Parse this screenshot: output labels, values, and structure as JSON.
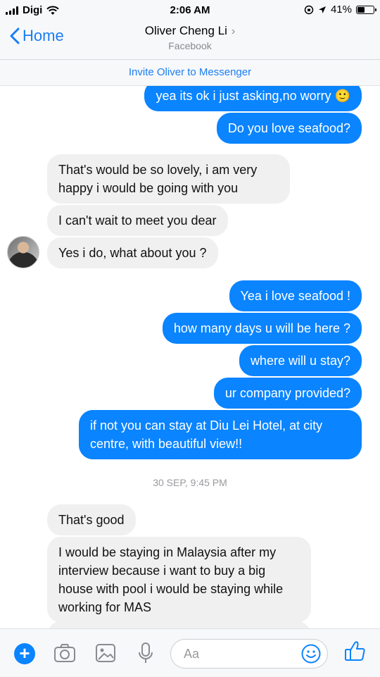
{
  "status_bar": {
    "carrier": "Digi",
    "time": "2:06 AM",
    "battery": "41%",
    "battery_level": 0.41
  },
  "header": {
    "back_label": "Home",
    "contact_name": "Oliver Cheng Li",
    "subtitle": "Facebook"
  },
  "invite_banner": "Invite Oliver to Messenger",
  "messages": [
    {
      "dir": "out",
      "text": "yea its ok i just asking,no worry 🙂"
    },
    {
      "dir": "out",
      "text": "Do you love seafood?"
    },
    {
      "dir": "in",
      "text": "That's would be so lovely, i am very happy i would be going with you"
    },
    {
      "dir": "in",
      "text": "I can't wait to meet you dear"
    },
    {
      "dir": "in",
      "text": "Yes i do, what about you ?"
    },
    {
      "dir": "out",
      "text": "Yea i love seafood !"
    },
    {
      "dir": "out",
      "text": "how many days u will be here ?"
    },
    {
      "dir": "out",
      "text": "where will u stay?"
    },
    {
      "dir": "out",
      "text": "ur company provided?"
    },
    {
      "dir": "out",
      "text": "if not you can stay at Diu Lei Hotel, at city centre, with beautiful view!!"
    },
    {
      "dir": "in",
      "text": "That's good"
    },
    {
      "dir": "in",
      "text": "I would be staying in Malaysia after my interview because i want to buy a big house with pool i would be staying while working for MAS"
    },
    {
      "dir": "in",
      "text": ""
    }
  ],
  "timestamp": "30 SEP, 9:45 PM",
  "composer": {
    "placeholder": "Aa"
  },
  "icons": {
    "add": "plus-circle-icon",
    "camera": "camera-icon",
    "gallery": "image-icon",
    "mic": "microphone-icon",
    "emoji": "smiley-icon",
    "like": "thumbs-up-icon"
  },
  "colors": {
    "accent": "#0a84ff",
    "incoming_bubble": "#f0f0f0",
    "link": "#1a7ef2"
  }
}
